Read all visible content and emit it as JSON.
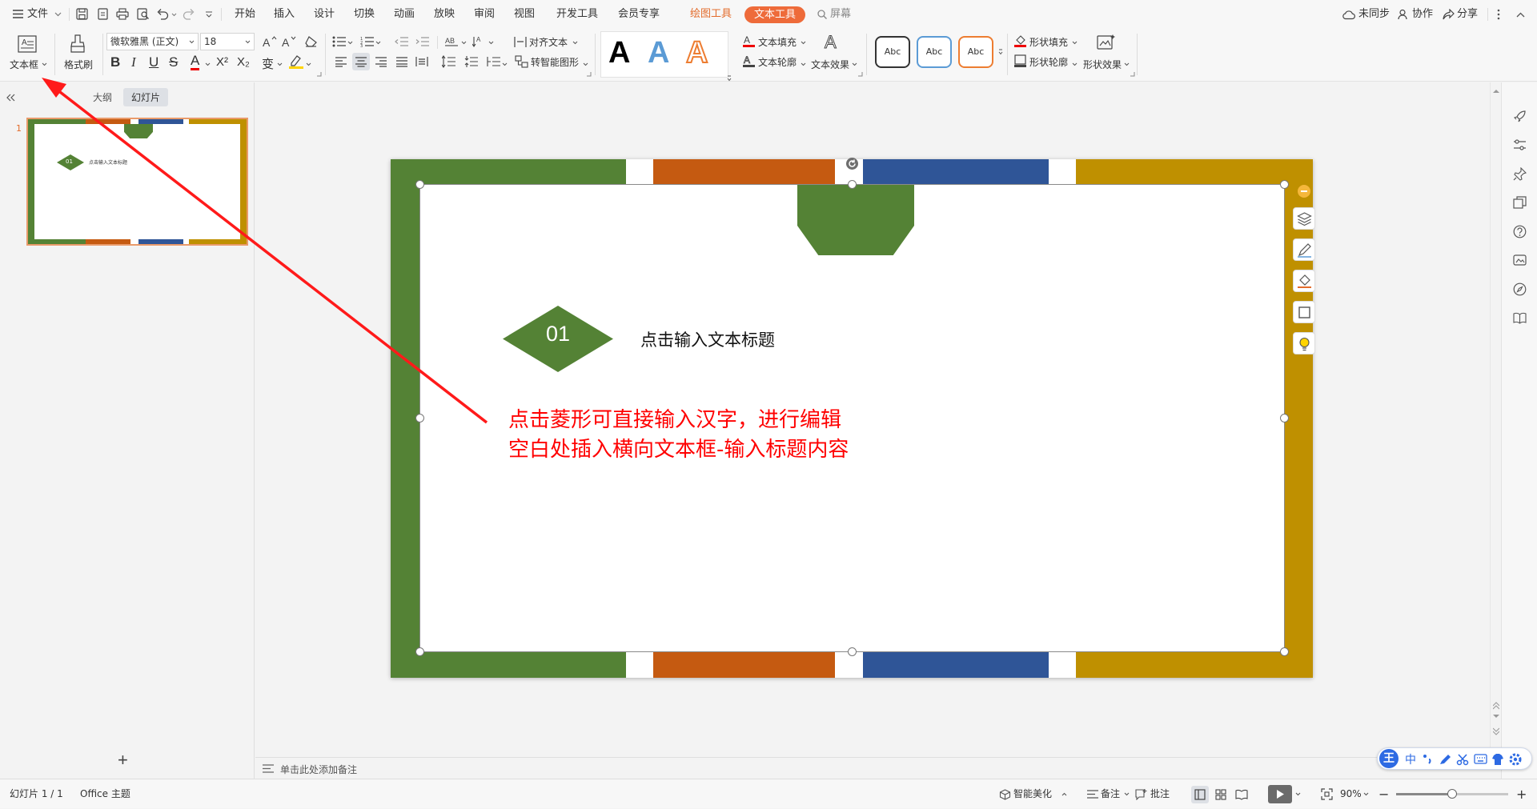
{
  "menubar": {
    "file_label": "文件",
    "tabs": [
      "开始",
      "插入",
      "设计",
      "切换",
      "动画",
      "放映",
      "审阅",
      "视图",
      "开发工具",
      "会员专享"
    ],
    "drawing_tools": "绘图工具",
    "text_tools": "文本工具",
    "search_label": "屏幕",
    "sync_label": "未同步",
    "collab_label": "协作",
    "share_label": "分享"
  },
  "ribbon": {
    "textbox_label": "文本框",
    "format_painter_label": "格式刷",
    "font_name": "微软雅黑 (正文)",
    "font_size": "18",
    "bold": "B",
    "italic": "I",
    "underline": "U",
    "strike": "S",
    "font_color": "A",
    "superscript": "X²",
    "subscript": "X₂",
    "phonetic": "变",
    "align_text_label": "对齐文本",
    "smart_art_label": "转智能图形",
    "wordart_letter": "A",
    "text_fill_label": "文本填充",
    "text_outline_label": "文本轮廓",
    "text_effect_label": "文本效果",
    "style_samples": [
      "Abc",
      "Abc",
      "Abc"
    ],
    "shape_fill_label": "形状填充",
    "shape_outline_label": "形状轮廓",
    "shape_effect_label": "形状效果"
  },
  "leftpanel": {
    "outline_tab": "大纲",
    "slides_tab": "幻灯片",
    "slide_number": "1",
    "thumb_badge": "01",
    "thumb_title": "点击输入文本标题",
    "add_button": "+"
  },
  "slide": {
    "badge_number": "01",
    "title_text": "点击输入文本标题",
    "annotation_line1": "点击菱形可直接输入汉字，进行编辑",
    "annotation_line2": "空白处插入横向文本框-输入标题内容",
    "colors": {
      "green": "#548235",
      "orange": "#c55a11",
      "blue": "#2f5597",
      "gold": "#bf9000",
      "annotation": "#ff0000"
    }
  },
  "notes": {
    "placeholder": "单击此处添加备注"
  },
  "statusbar": {
    "slide_info": "幻灯片 1 / 1",
    "theme": "Office 主题",
    "beautify_label": "智能美化",
    "notes_label": "备注",
    "comment_label": "批注",
    "zoom_level": "90%",
    "zoom_fraction": 0.5
  },
  "ime": {
    "logo": "王",
    "mode": "中"
  }
}
